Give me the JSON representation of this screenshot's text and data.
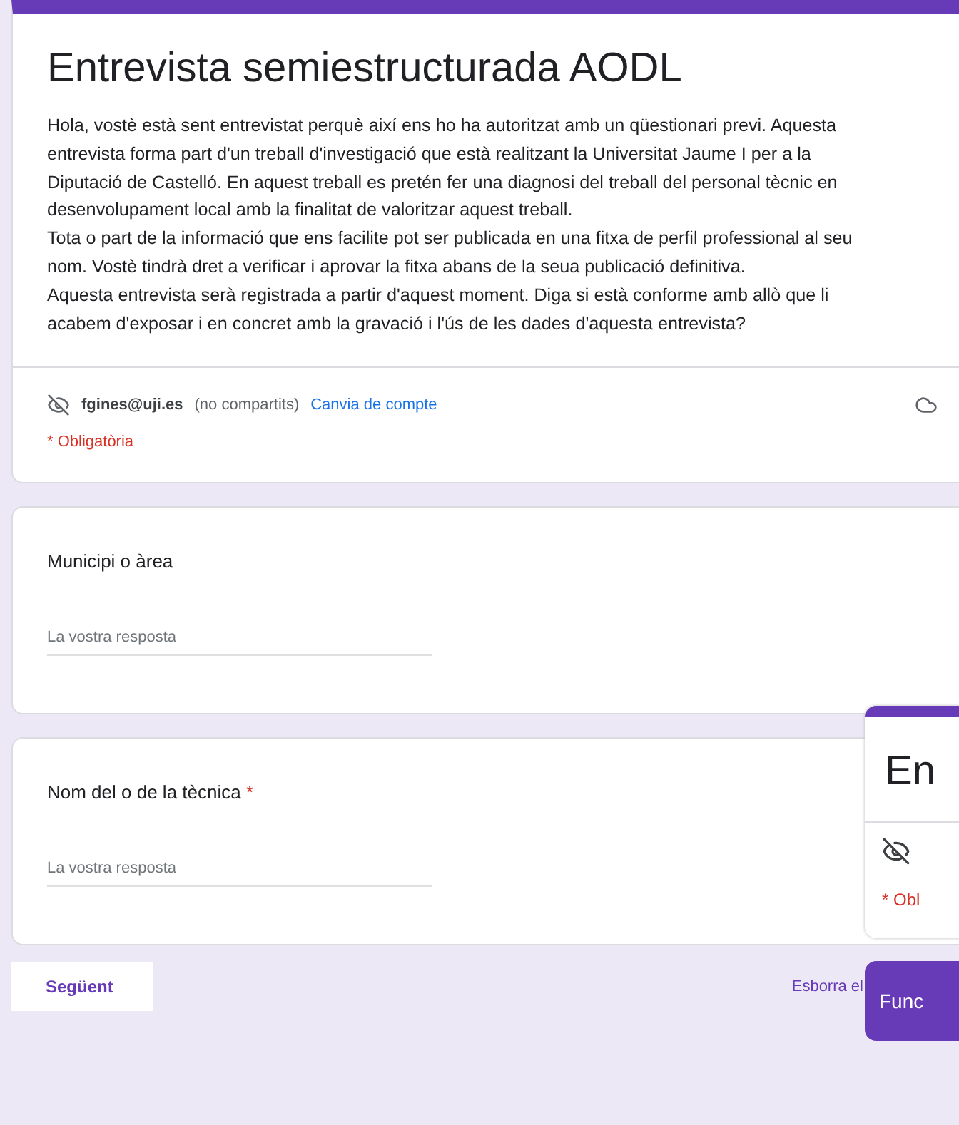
{
  "form": {
    "title": "Entrevista semiestructurada AODL",
    "description": [
      "Hola, vostè està sent entrevistat perquè així ens ho ha autoritzat amb un qüestionari previ. Aquesta entrevista forma part d'un treball d'investigació que està realitzant la Universitat Jaume I per a la Diputació de Castelló. En aquest treball es pretén fer una diagnosi del treball del personal tècnic en desenvolupament local amb la finalitat de valoritzar aquest treball.",
      "Tota o part de la informació que ens facilite pot ser publicada en una fitxa de perfil professional al seu nom. Vostè tindrà dret a verificar i aprovar la fitxa abans de la seua publicació definitiva.",
      "Aquesta entrevista serà registrada a partir d'aquest moment. Diga si està conforme amb allò que li acabem d'exposar i en concret amb la gravació i l'ús de les dades d'aquesta entrevista?"
    ],
    "account": {
      "email": "fgines@uji.es",
      "note": "(no compartits)",
      "link": "Canvia de compte"
    },
    "required_note": "* Obligatòria"
  },
  "questions": [
    {
      "label": "Municipi o àrea",
      "placeholder": "La vostra resposta"
    },
    {
      "label": "Nom del o de la tècnica",
      "required_mark": "*",
      "placeholder": "La vostra resposta"
    }
  ],
  "footer": {
    "next": "Següent",
    "clear": "Esborra el"
  },
  "overlay_window": {
    "title": "En",
    "required_note": "* Obl",
    "button": "Func"
  }
}
